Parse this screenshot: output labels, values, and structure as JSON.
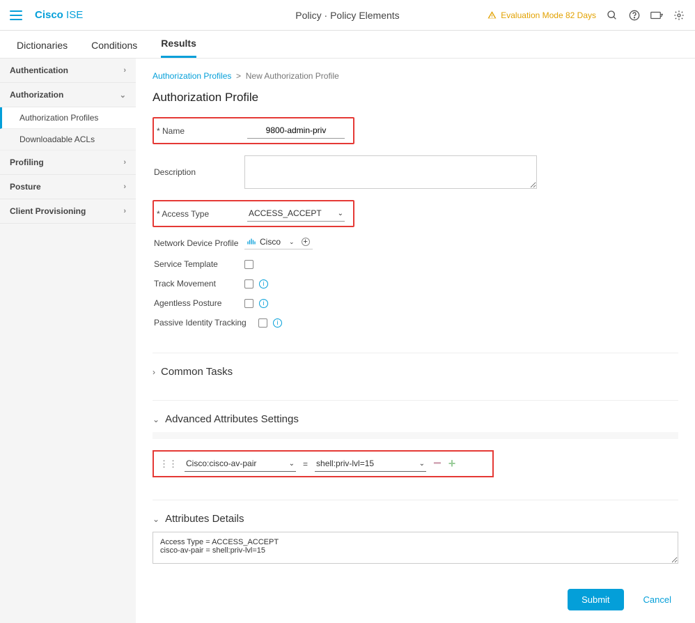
{
  "header": {
    "brand_main": "Cisco",
    "brand_sub": "ISE",
    "page_title": "Policy · Policy Elements",
    "eval_text": "Evaluation Mode 82 Days"
  },
  "tabs": [
    "Dictionaries",
    "Conditions",
    "Results"
  ],
  "active_tab": 2,
  "sidebar": {
    "items": [
      {
        "label": "Authentication",
        "type": "group"
      },
      {
        "label": "Authorization",
        "type": "group",
        "open": true
      },
      {
        "label": "Authorization Profiles",
        "type": "sub",
        "active": true
      },
      {
        "label": "Downloadable ACLs",
        "type": "sub"
      },
      {
        "label": "Profiling",
        "type": "group"
      },
      {
        "label": "Posture",
        "type": "group"
      },
      {
        "label": "Client Provisioning",
        "type": "group"
      }
    ]
  },
  "crumbs": {
    "root": "Authorization Profiles",
    "current": "New Authorization Profile"
  },
  "page_heading": "Authorization Profile",
  "form": {
    "name_label": "Name",
    "name_value": "9800-admin-priv",
    "desc_label": "Description",
    "desc_value": "",
    "access_type_label": "Access Type",
    "access_type_value": "ACCESS_ACCEPT",
    "net_dev_label": "Network Device Profile",
    "net_dev_value": "Cisco",
    "service_template_label": "Service Template",
    "track_movement_label": "Track Movement",
    "agentless_label": "Agentless Posture",
    "passive_label": "Passive Identity Tracking"
  },
  "sections": {
    "common": "Common Tasks",
    "advanced": "Advanced Attributes Settings",
    "attr_details": "Attributes Details"
  },
  "advanced": {
    "attribute": "Cisco:cisco-av-pair",
    "value": "shell:priv-lvl=15"
  },
  "attr_details_lines": [
    "Access Type = ACCESS_ACCEPT",
    "cisco-av-pair = shell:priv-lvl=15"
  ],
  "buttons": {
    "submit": "Submit",
    "cancel": "Cancel"
  }
}
